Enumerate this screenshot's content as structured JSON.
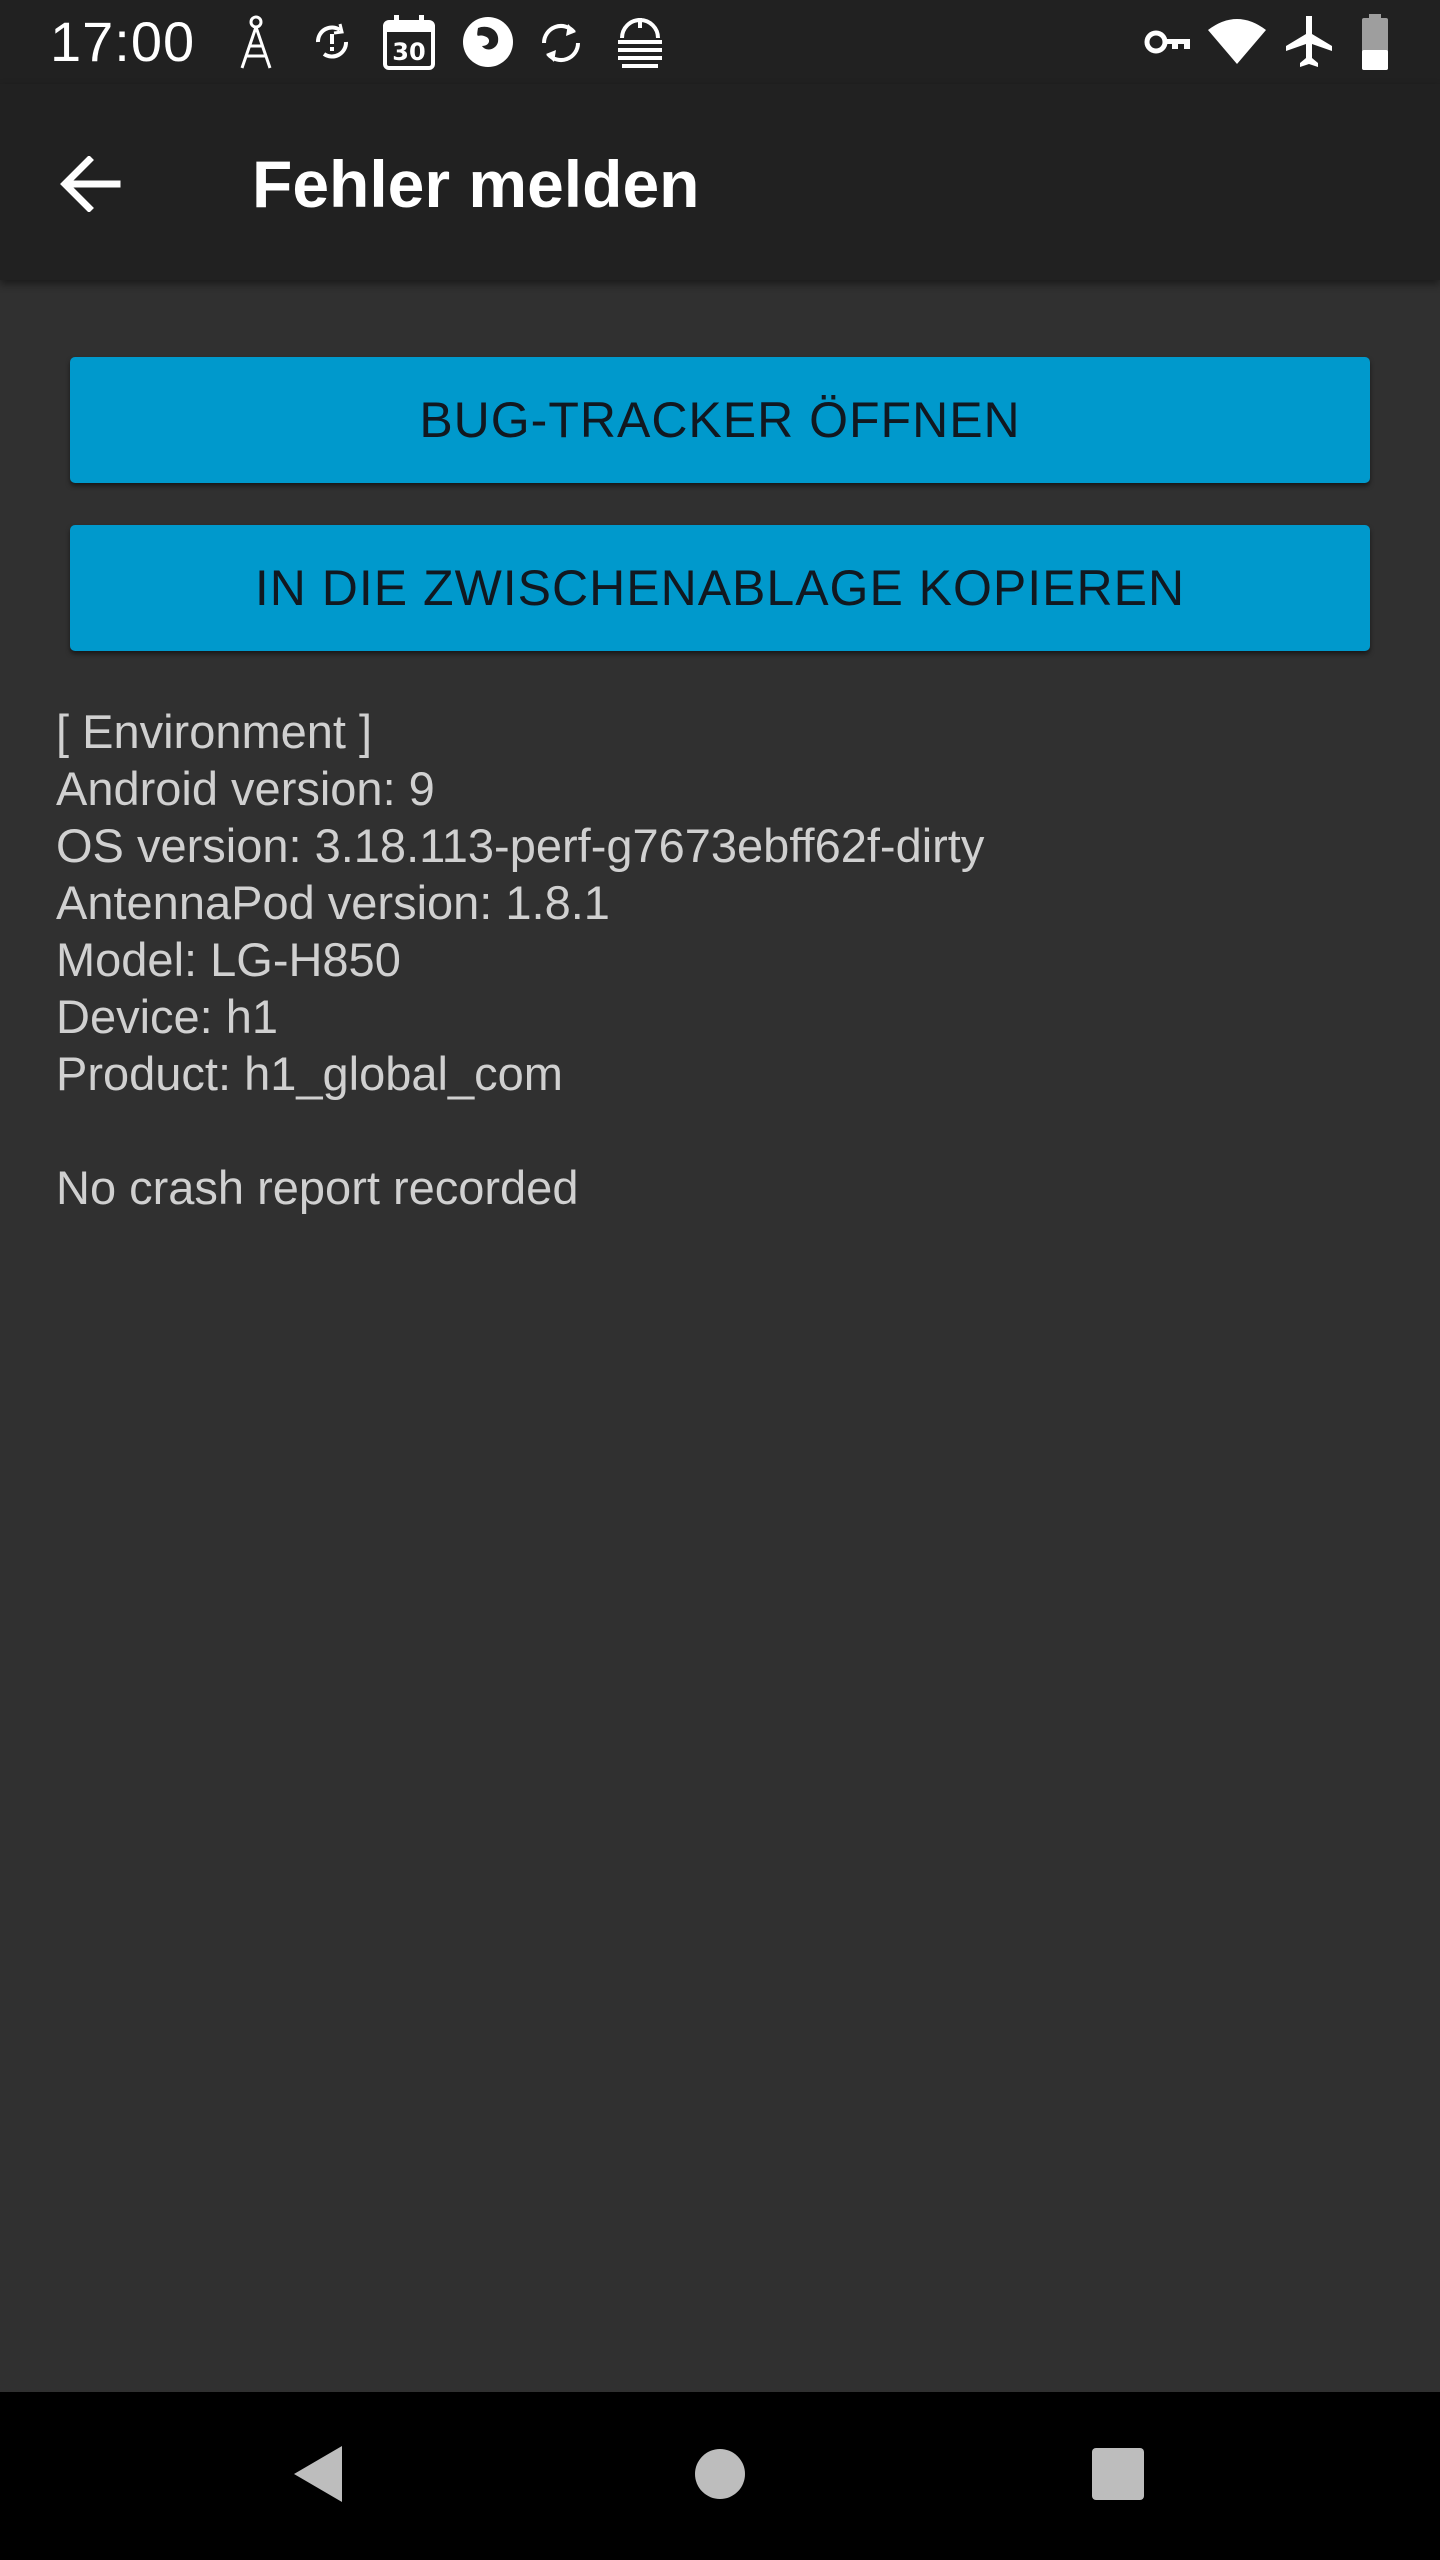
{
  "status_bar": {
    "time": "17:00",
    "left_icons": [
      "antenna-icon",
      "sync-problem-icon",
      "calendar-icon",
      "firefox-icon",
      "sync-icon",
      "antennapod-icon"
    ],
    "calendar_day": "30",
    "right_icons": [
      "vpn-key-icon",
      "wifi-icon",
      "airplane-mode-icon",
      "battery-icon"
    ]
  },
  "app_bar": {
    "title": "Fehler melden",
    "back_icon": "arrow-back-icon"
  },
  "buttons": {
    "open_bug_tracker": "BUG-TRACKER ÖFFNEN",
    "copy_to_clipboard": "IN DIE ZWISCHENABLAGE KOPIEREN"
  },
  "environment": {
    "header": "[ Environment ]",
    "android_version": "Android version: 9",
    "os_version": "OS version: 3.18.113-perf-g7673ebff62f-dirty",
    "antennapod_version": "AntennaPod version: 1.8.1",
    "model": "Model: LG-H850",
    "device": "Device: h1",
    "product": "Product: h1_global_com"
  },
  "crash_report": "No crash report recorded",
  "nav_bar": {
    "back": "nav-back-icon",
    "home": "nav-home-icon",
    "recents": "nav-recents-icon"
  },
  "colors": {
    "background": "#303030",
    "app_bar": "#212121",
    "button": "#0099cc",
    "text": "#d0d0d0"
  }
}
